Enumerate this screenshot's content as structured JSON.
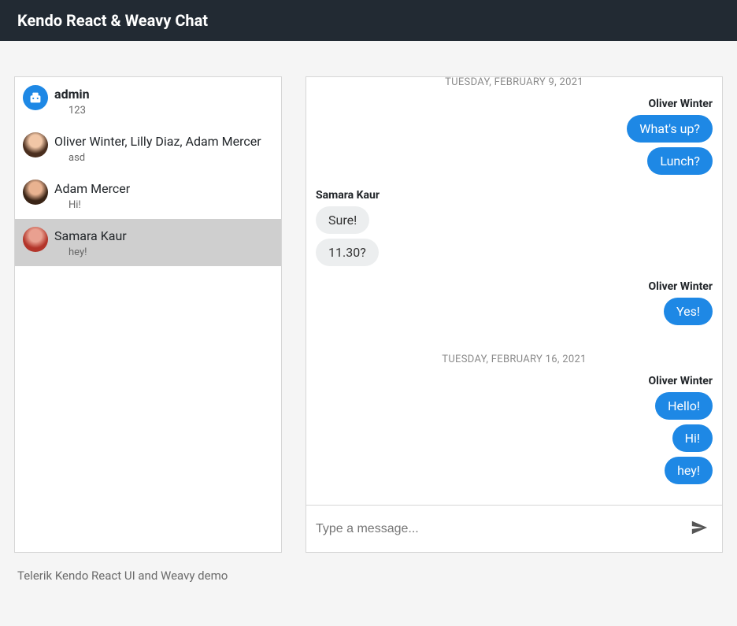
{
  "header": {
    "title": "Kendo React & Weavy Chat"
  },
  "sidebar": {
    "conversations": [
      {
        "name": "admin",
        "preview": "123",
        "bold": true,
        "avatar": "admin"
      },
      {
        "name": "Oliver Winter, Lilly Diaz, Adam Mercer",
        "preview": "asd",
        "bold": false,
        "avatar": "group"
      },
      {
        "name": "Adam Mercer",
        "preview": "Hi!",
        "bold": false,
        "avatar": "av2"
      },
      {
        "name": "Samara Kaur",
        "preview": "hey!",
        "bold": false,
        "avatar": "av3",
        "selected": true
      }
    ]
  },
  "chat": {
    "days": [
      {
        "label": "TUESDAY, FEBRUARY 9, 2021",
        "groups": [
          {
            "side": "right",
            "sender": "Oliver Winter",
            "messages": [
              "What's up?",
              "Lunch?"
            ]
          },
          {
            "side": "left",
            "sender": "Samara Kaur",
            "messages": [
              "Sure!",
              "11.30?"
            ]
          },
          {
            "side": "right",
            "sender": "Oliver Winter",
            "messages": [
              "Yes!"
            ]
          }
        ]
      },
      {
        "label": "TUESDAY, FEBRUARY 16, 2021",
        "groups": [
          {
            "side": "right",
            "sender": "Oliver Winter",
            "messages": [
              "Hello!",
              "Hi!",
              "hey!"
            ]
          }
        ]
      }
    ],
    "composer": {
      "placeholder": "Type a message..."
    }
  },
  "footer": {
    "text": "Telerik Kendo React UI and Weavy demo"
  }
}
